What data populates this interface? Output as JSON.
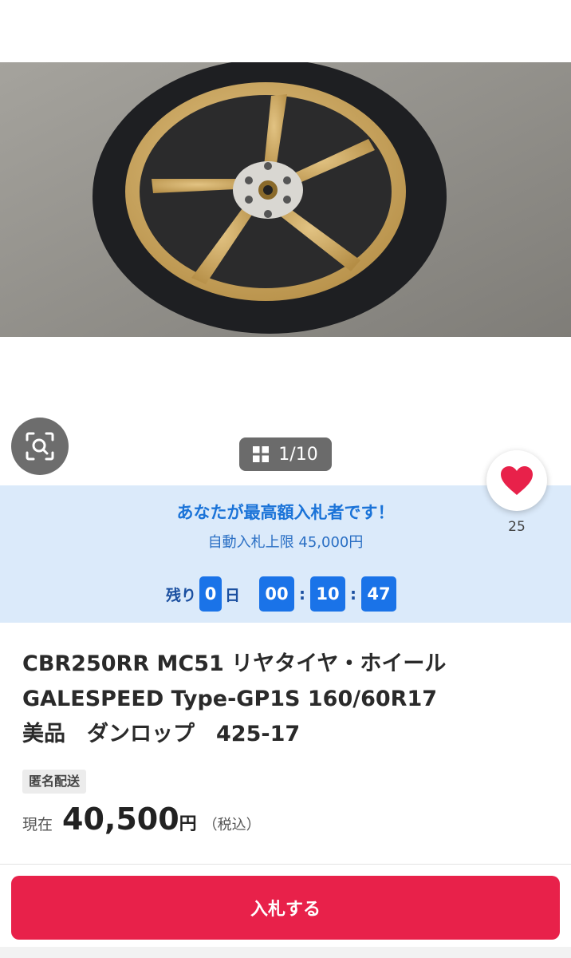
{
  "gallery": {
    "current": 1,
    "total": 10,
    "counter_text": "1/10"
  },
  "bid_status": {
    "message": "あなたが最高額入札者です！",
    "auto_limit": "自動入札上限 45,000円"
  },
  "timer": {
    "remaining_label": "残り",
    "days": "0",
    "days_unit": "日",
    "hours": "00",
    "minutes": "10",
    "seconds": "47",
    "separator": ":"
  },
  "favorite": {
    "count": "25"
  },
  "item": {
    "title_lines": [
      "CBR250RR MC51 リヤタイヤ・ホイール",
      "GALESPEED Type-GP1S 160/60R17",
      "美品　ダンロップ　425-17"
    ],
    "shipping_badge": "匿名配送"
  },
  "price": {
    "label": "現在",
    "value": "40,500",
    "unit": "円",
    "tax": "（税込）"
  },
  "actions": {
    "bid_button": "入札する"
  },
  "colors": {
    "bid_button": "#e8214a",
    "bid_panel_bg": "#dbeafa",
    "timer_box": "#1a73e8",
    "heart": "#e8214a",
    "wheel_gold": "#c9a45c"
  }
}
